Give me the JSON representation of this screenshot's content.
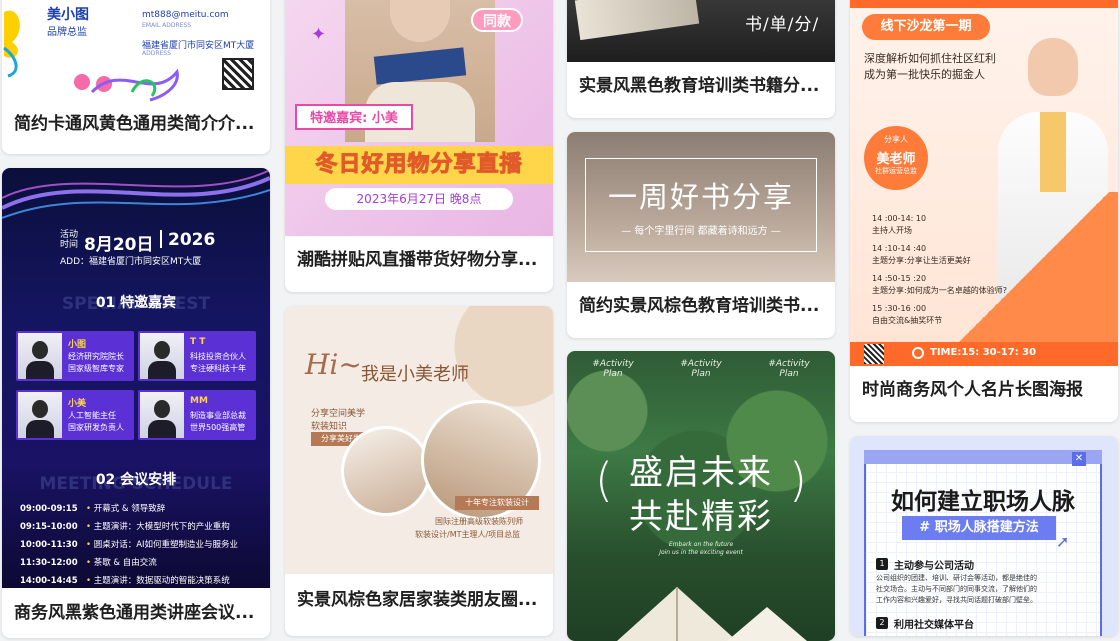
{
  "cards": {
    "c1": {
      "title": "简约卡通风黄色通用类简介介...",
      "brand": "美小图",
      "brand_sub": "品牌总监",
      "email": "mt888@meitu.com",
      "email_label": "EMAIL ADDRESS",
      "address": "福建省厦门市同安区MT大厦",
      "address_label": "ADDRESS"
    },
    "c2": {
      "title": "商务风黑紫色通用类讲座会议...",
      "time_label_1": "活动",
      "time_label_2": "时间",
      "date": "8月20日",
      "year": "2026",
      "address": "ADD：福建省厦门市同安区MT大厦",
      "section1": "01 特邀嘉宾",
      "watermark1": "SPECIAL GUEST",
      "guests": [
        {
          "name": "小图",
          "l1": "经济研究院院长",
          "l2": "国家级智库专家"
        },
        {
          "name": "T T",
          "l1": "科技投资合伙人",
          "l2": "专注硬科技十年"
        },
        {
          "name": "小美",
          "l1": "人工智能主任",
          "l2": "国家研发负责人"
        },
        {
          "name": "MM",
          "l1": "制造事业部总裁",
          "l2": "世界500强高管"
        }
      ],
      "section2": "02 会议安排",
      "watermark2": "MEETING SCHEDULE",
      "schedule": [
        {
          "time": "09:00-09:15",
          "item": "开幕式 & 领导致辞"
        },
        {
          "time": "09:15-10:00",
          "item": "主题演讲：大模型时代下的产业重构"
        },
        {
          "time": "10:00-11:30",
          "item": "圆桌对话：AI如何重塑制造业与服务业"
        },
        {
          "time": "11:30-12:00",
          "item": "茶歇 & 自由交流"
        },
        {
          "time": "14:00-14:45",
          "item": "主题演讲：数据驱动的智能决策系统"
        }
      ]
    },
    "c3": {
      "title": "潮酷拼贴风直播带货好物分享...",
      "badge": "同款",
      "guest": "特邀嘉宾: 小美",
      "headline": "冬日好用物分享直播",
      "date": "2023年6月27日  晚8点"
    },
    "c4": {
      "title": "实景风棕色家居家装类朋友圈...",
      "greeting": "Hi~",
      "headline": "我是小美老师",
      "line1": "分享空间美学",
      "line2": "软装知识",
      "tag": "分享美好生活",
      "years": "十年专注软装设计",
      "bio1": "国际注册高级软装陈列师",
      "bio2": "软装设计/MT主理人/项目总监"
    },
    "c5": {
      "title": "实景风黑色教育培训类书籍分...",
      "partial_text": "书/单/分/"
    },
    "c6": {
      "title": "简约实景风棕色教育培训类书...",
      "headline": "一周好书分享",
      "sub": "— 每个字里行间  都藏着诗和远方 —"
    },
    "c7": {
      "script1": "#Activity",
      "script2": "Plan",
      "line1": "盛启未来",
      "line2": "共赴精彩",
      "small1": "Embark on the future",
      "small2": "Join us in the exciting event"
    },
    "c8": {
      "title": "时尚商务风个人名片长图海报",
      "pill": "线下沙龙第一期",
      "intro1": "深度解析如何抓住社区红利",
      "intro2": "成为第一批快乐的掘金人",
      "sharer_label": "分享人",
      "sharer_name": "美老师",
      "sharer_role": "社群运营总监",
      "agenda": [
        {
          "time": "14 :00-14: 10",
          "text": "主持人开场"
        },
        {
          "time": "14 :10-14 :40",
          "text": "主题分享:分享让生活更美好"
        },
        {
          "time": "14 :50-15 :20",
          "text": "主题分享:如何成为一名卓越的体验师?"
        },
        {
          "time": "15 :30-16 :00",
          "text": "自由交流&抽奖环节"
        }
      ],
      "footer_time": "TIME:15: 30-17: 30"
    },
    "c9": {
      "headline": "如何建立职场人脉",
      "tag": "# 职场人脉搭建方法",
      "point1_title": "主动参与公司活动",
      "point1_body1": "公司组织的团建、培训、研讨会等活动，都是绝佳的",
      "point1_body2": "社交场合。主动与不同部门的同事交流，了解他们的",
      "point1_body3": "工作内容和兴趣爱好，寻找共同话题打破部门壁垒。",
      "point2_title": "利用社交媒体平台",
      "n1": "1",
      "n2": "2"
    }
  },
  "colors": {
    "purple": "#6a3fe0",
    "pink": "#e84aa5",
    "yellow": "#ffd64a",
    "orange": "#ff7b3a",
    "blue_text": "#2a3cc7"
  }
}
